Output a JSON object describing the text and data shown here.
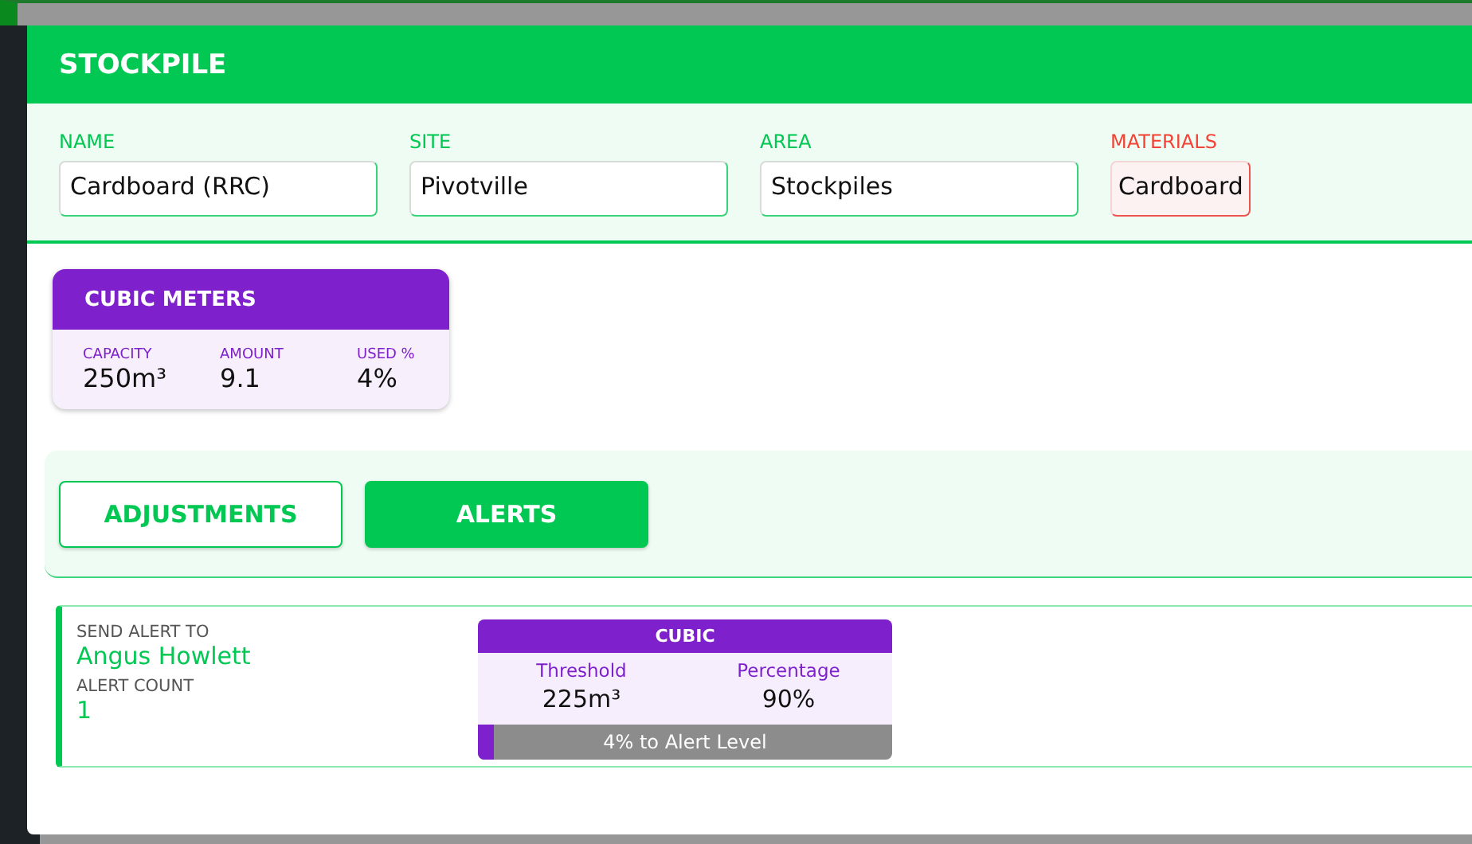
{
  "dialog": {
    "title": "STOCKPILE"
  },
  "fields": [
    {
      "label": "NAME",
      "value": "Cardboard (RRC)",
      "kind": "text"
    },
    {
      "label": "SITE",
      "value": "Pivotville",
      "kind": "text"
    },
    {
      "label": "AREA",
      "value": "Stockpiles",
      "kind": "text"
    },
    {
      "label": "MATERIALS",
      "value": "Cardboard",
      "kind": "tag"
    }
  ],
  "summary_card": {
    "title": "CUBIC METERS",
    "stats": [
      {
        "label": "CAPACITY",
        "value": "250m³"
      },
      {
        "label": "AMOUNT",
        "value": "9.1"
      },
      {
        "label": "USED %",
        "value": "4%"
      }
    ]
  },
  "tabs": [
    {
      "label": "ADJUSTMENTS",
      "selected": false
    },
    {
      "label": "ALERTS",
      "selected": true
    }
  ],
  "alert": {
    "send_to_label": "SEND ALERT TO",
    "send_to": "Angus Howlett",
    "count_label": "ALERT COUNT",
    "count": "1",
    "card": {
      "title": "CUBIC",
      "columns": [
        {
          "label": "Threshold",
          "value": "225m³"
        },
        {
          "label": "Percentage",
          "value": "90%"
        }
      ],
      "level": 0.04,
      "progress_text": "4% to Alert Level"
    }
  }
}
